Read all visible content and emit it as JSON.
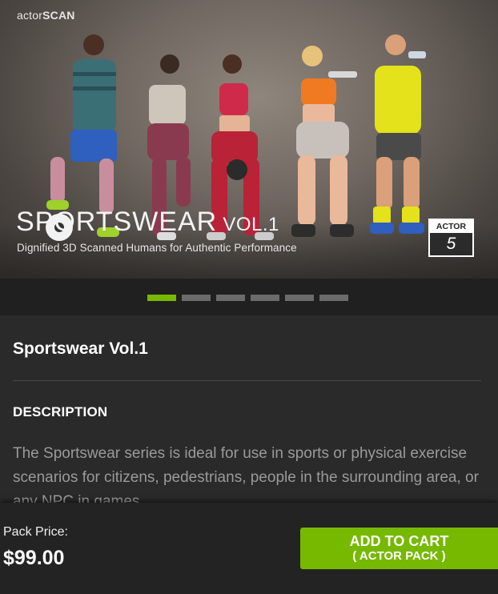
{
  "hero": {
    "brand_light": "actor",
    "brand_bold": "SCAN",
    "title_main": "SPORTSWEAR",
    "title_vol": " VOL.1",
    "subtitle": "Dignified 3D Scanned Humans for Authentic Performance",
    "badge_label": "ACTOR",
    "badge_count": "5"
  },
  "carousel": {
    "slides": 6,
    "active_index": 0,
    "active_color": "#76b900"
  },
  "product": {
    "title": "Sportswear Vol.1",
    "description_heading": "DESCRIPTION",
    "description_text": "The Sportswear series is ideal for use in sports or physical exercise scenarios for citizens, pedestrians, people in the surrounding area, or any NPC in games."
  },
  "footer": {
    "price_label": "Pack Price:",
    "price": "$99.00",
    "cart_line1": "ADD TO CART",
    "cart_line2": "( ACTOR PACK )"
  },
  "colors": {
    "accent": "#76b900",
    "background": "#2a2a2a"
  }
}
